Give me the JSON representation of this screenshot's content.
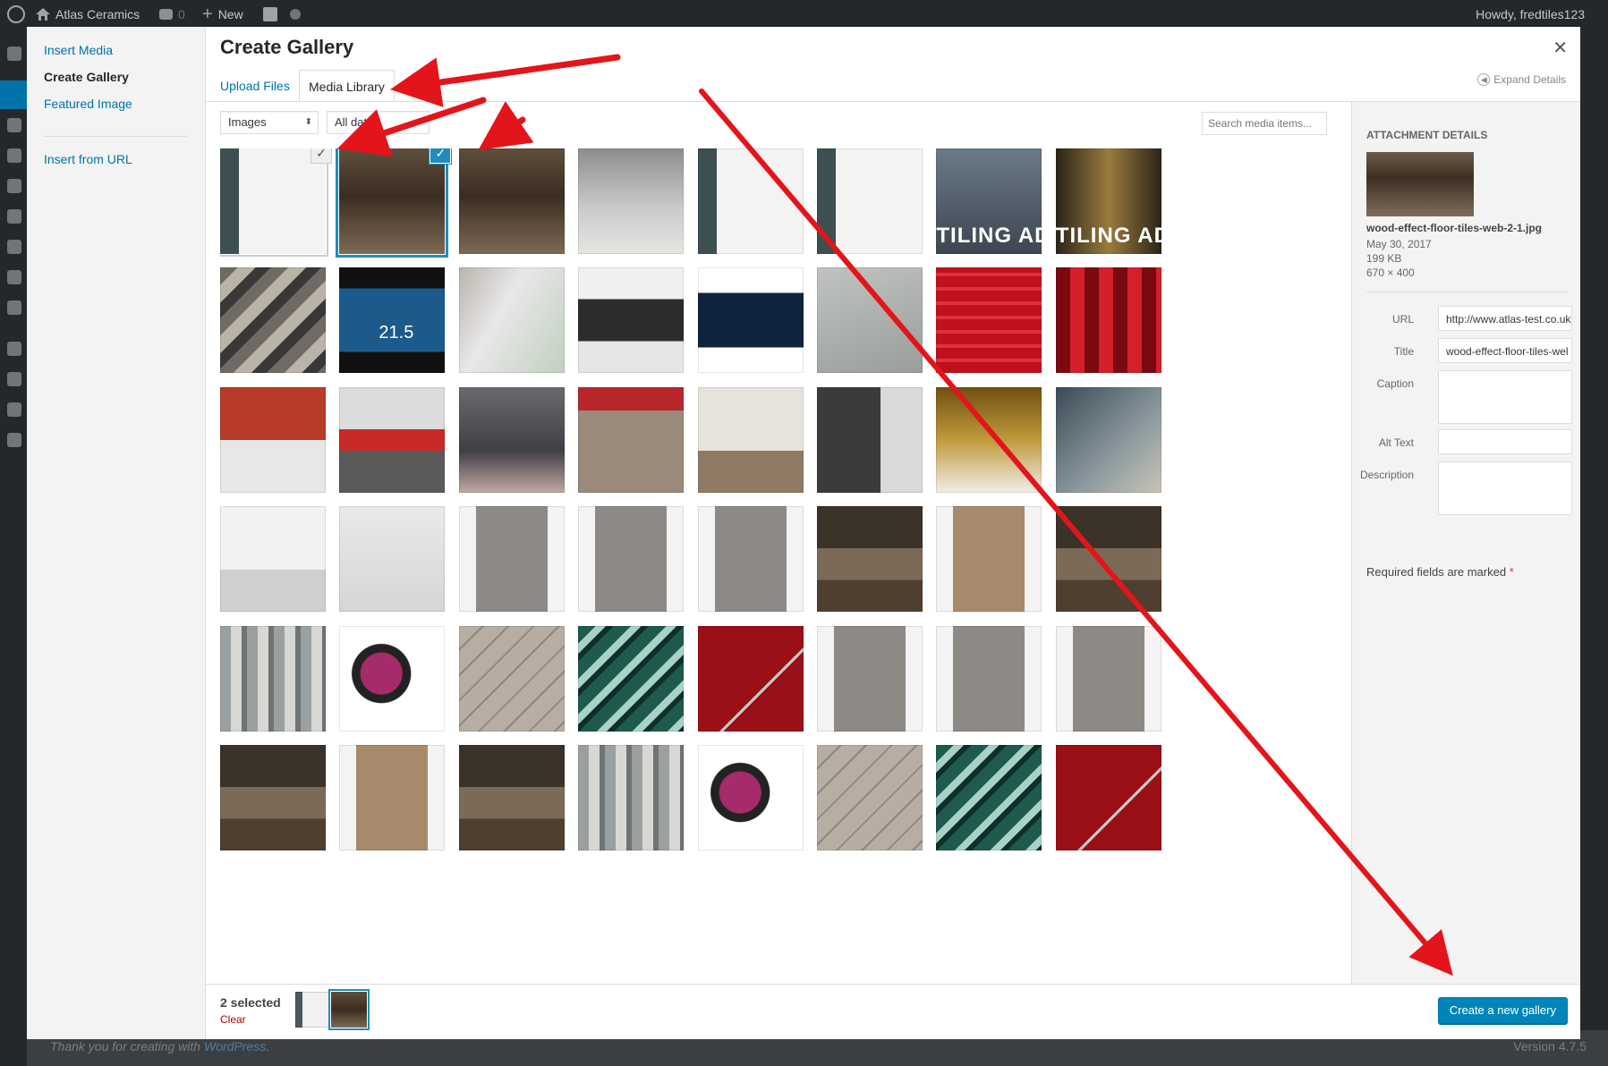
{
  "admin_bar": {
    "site_name": "Atlas Ceramics",
    "comments_count": "0",
    "new_label": "New",
    "greeting": "Howdy, fredtiles123"
  },
  "footer": {
    "thanks_prefix": "Thank you for creating with",
    "thanks_link": "WordPress",
    "thanks_suffix": ".",
    "version": "Version 4.7.5"
  },
  "media_menu": {
    "items": [
      "Insert Media",
      "Create Gallery",
      "Featured Image",
      "Insert from URL"
    ],
    "active": "Create Gallery"
  },
  "frame": {
    "title": "Create Gallery",
    "close_icon": "close-icon",
    "tabs": [
      "Upload Files",
      "Media Library"
    ],
    "active_tab": "Media Library",
    "expand_details": "Expand Details"
  },
  "toolbar": {
    "type_filter": "Images",
    "date_filter": "All dates",
    "search_placeholder": "Search media items..."
  },
  "sidebar": {
    "heading": "Attachment Details",
    "filename": "wood-effect-floor-tiles-web-2-1.jpg",
    "date": "May 30, 2017",
    "size": "199 KB",
    "dimensions": "670 × 400",
    "fields": {
      "url_label": "URL",
      "url_value": "http://www.atlas-test.co.uk",
      "title_label": "Title",
      "title_value": "wood-effect-floor-tiles-wel",
      "caption_label": "Caption",
      "alt_label": "Alt Text",
      "description_label": "Description"
    },
    "required_note": "Required fields are marked",
    "required_star": "*"
  },
  "bottom_bar": {
    "selected_count": "2 selected",
    "clear_label": "Clear",
    "create_button": "Create a new gallery"
  },
  "grid": {
    "thumbs": [
      "bath-white",
      "bedroom-wood",
      "bedroom-wood",
      "basin-mosaic",
      "bath-white",
      "bath-white",
      "tiling-advice",
      "tiling-advice-corridor",
      "mosaic-grey",
      "thermostat",
      "phone-app",
      "warmup-screen",
      "warmup-ad",
      "grey-pebble",
      "red-tiles",
      "red-mosaic",
      "red-kitchen",
      "kitchen-splash",
      "showroom-people",
      "cheque",
      "kitchen-island",
      "grey-bathroom",
      "gold-bathroom",
      "slate-floor",
      "white-kitchen",
      "white-living",
      "grey-plank",
      "grey-plank",
      "grey-plank",
      "wood-room",
      "wood-plank",
      "wood-room",
      "grey-mosaic",
      "knee-pads",
      "beige-tiles",
      "green-glass",
      "red-sparkle",
      "grey-plank",
      "grey-plank",
      "grey-plank",
      "wood-room",
      "wood-plank",
      "wood-room",
      "grey-mosaic",
      "knee-pads",
      "beige-tiles",
      "green-glass",
      "red-sparkle"
    ],
    "tiling_text": "TILING ADVI",
    "thermostat_reading": "21.5"
  }
}
